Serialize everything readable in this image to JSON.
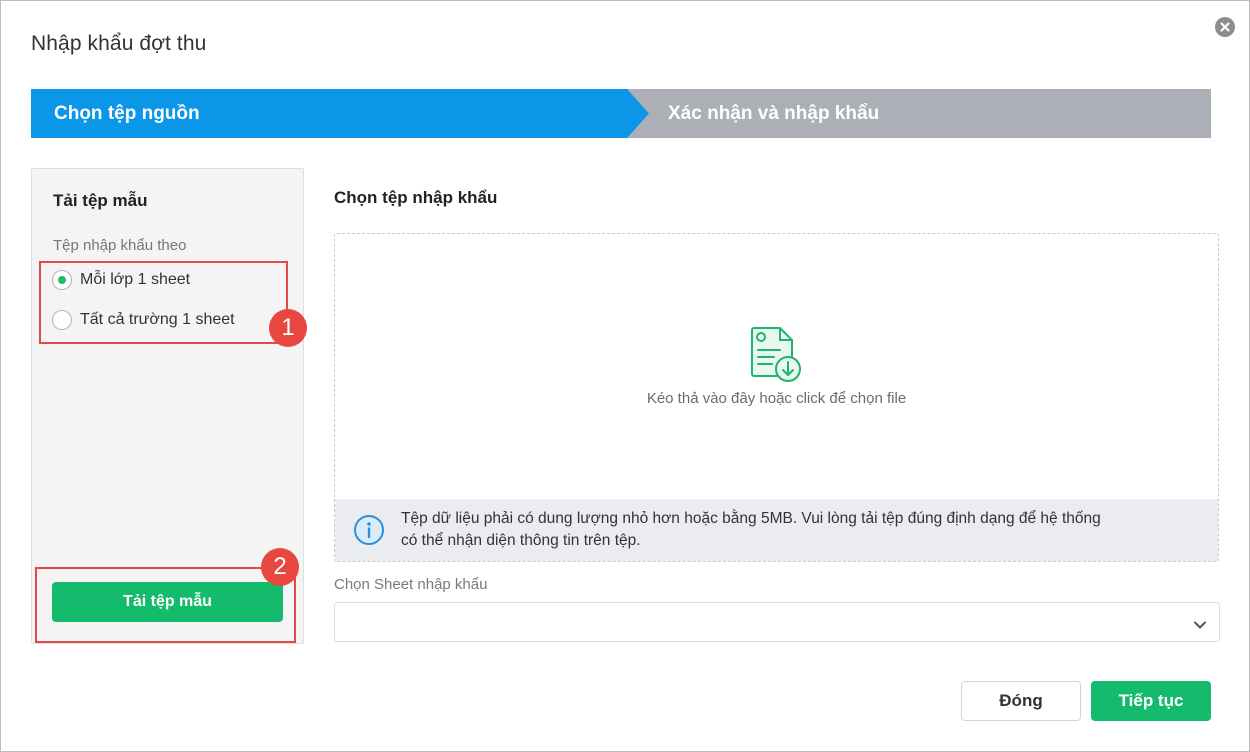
{
  "dialog": {
    "title": "Nhập khẩu đợt thu"
  },
  "stepper": {
    "steps": [
      {
        "label": "Chọn tệp nguồn",
        "active": true
      },
      {
        "label": "Xác nhận và nhập khẩu",
        "active": false
      }
    ],
    "active_color": "#0b96e8",
    "inactive_color": "#acb0b6"
  },
  "template_panel": {
    "title": "Tải tệp mẫu",
    "subtitle": "Tệp nhập khẩu theo",
    "options": [
      {
        "label": "Mỗi lớp 1 sheet",
        "selected": true
      },
      {
        "label": "Tất cả trường 1 sheet",
        "selected": false
      }
    ],
    "download_button": "Tải tệp mẫu"
  },
  "annotations": [
    {
      "number": "1"
    },
    {
      "number": "2"
    }
  ],
  "import_file": {
    "title": "Chọn tệp nhập khẩu",
    "dropzone_text": "Kéo thả vào đây hoặc click để chọn file",
    "dropzone_icon": "file-download-icon",
    "info_icon": "info-icon",
    "info_text_line1": "Tệp dữ liệu phải có dung lượng nhỏ hơn hoặc bằng 5MB. Vui lòng tải tệp đúng định dạng để hệ thống",
    "info_text_line2": "có thể nhận diện thông tin trên tệp."
  },
  "sheet_select": {
    "label": "Chọn Sheet nhập khẩu",
    "value": "",
    "icon": "chevron-down-icon"
  },
  "footer": {
    "close_label": "Đóng",
    "next_label": "Tiếp tục"
  },
  "colors": {
    "primary_green": "#14bb6c",
    "annotation_red": "#e8473f"
  }
}
